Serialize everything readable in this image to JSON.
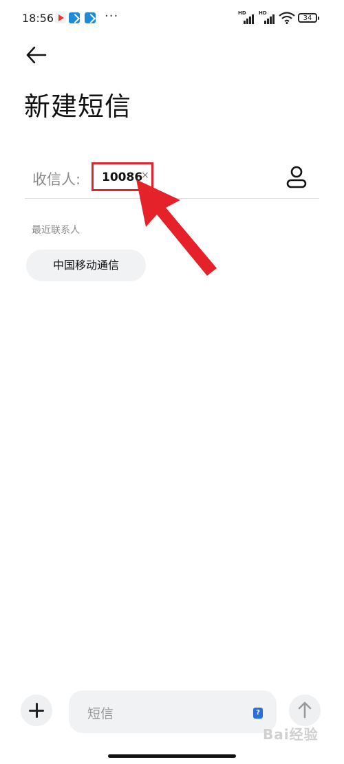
{
  "status_bar": {
    "time": "18:56",
    "more": "···",
    "signal_tag": "HD",
    "battery": "34"
  },
  "header": {
    "title": "新建短信"
  },
  "recipient": {
    "label": "收信人:",
    "chip_value": "10086",
    "chip_remove": "×"
  },
  "recent": {
    "title": "最近联系人",
    "contacts": [
      "中国移动通信"
    ]
  },
  "composer": {
    "placeholder": "短信",
    "sim_badge": "?"
  },
  "watermark": "Bai经验",
  "colors": {
    "highlight": "#e5212a",
    "sim_badge": "#2a6fe0"
  },
  "icons": [
    "back-arrow-icon",
    "contact-icon",
    "plus-icon",
    "send-arrow-icon"
  ]
}
